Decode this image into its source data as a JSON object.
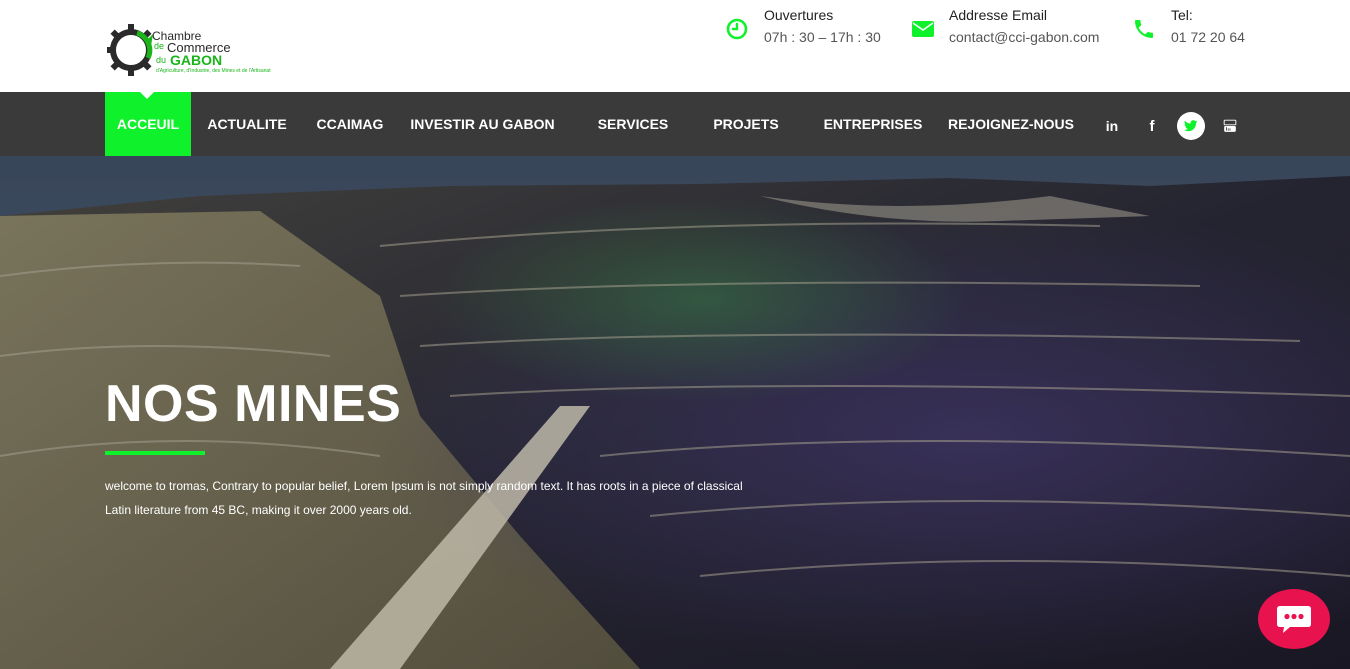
{
  "logo": {
    "line1": "Chambre",
    "line2a": "de",
    "line2b": "Commerce",
    "line3a": "du",
    "line3b": "GABON",
    "tagline": "d'Agriculture, d'Industrie, des Mines et de l'Artisanat"
  },
  "contact": {
    "hours": {
      "label": "Ouvertures",
      "value": "07h : 30 – 17h : 30",
      "icon": "clock-icon"
    },
    "email": {
      "label": "Addresse Email",
      "value": "contact@cci-gabon.com",
      "icon": "envelope-icon"
    },
    "phone": {
      "label": "Tel:",
      "value": "01 72 20 64",
      "icon": "phone-icon"
    }
  },
  "nav": {
    "items": [
      {
        "label": "ACCEUIL",
        "active": true
      },
      {
        "label": "ACTUALITE"
      },
      {
        "label": "CCAIMAG"
      },
      {
        "label": "INVESTIR AU GABON"
      },
      {
        "label": "SERVICES"
      },
      {
        "label": "PROJETS"
      },
      {
        "label": "ENTREPRISES"
      },
      {
        "label": "REJOIGNEZ-NOUS"
      }
    ],
    "social": [
      {
        "name": "linkedin-icon",
        "glyph": "in"
      },
      {
        "name": "facebook-icon",
        "glyph": "f"
      },
      {
        "name": "twitter-icon",
        "glyph": ""
      },
      {
        "name": "youtube-icon",
        "glyph": ""
      }
    ]
  },
  "hero": {
    "title": "NOS MINES",
    "text": "welcome to tromas, Contrary to popular belief, Lorem Ipsum is not simply random text. It has roots in a piece of classical Latin literature from 45 BC, making it over 2000 years old."
  },
  "colors": {
    "accent": "#0ef12b",
    "nav_bg": "#3a3a3a",
    "chat": "#e8124f"
  }
}
